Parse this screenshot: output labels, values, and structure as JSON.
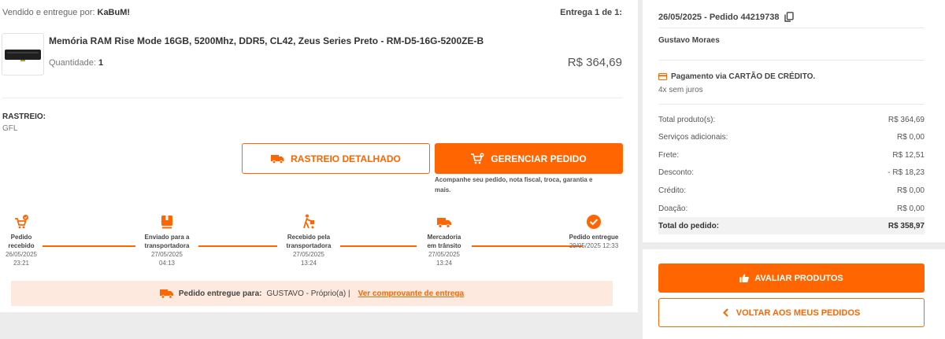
{
  "seller": {
    "prefix": "Vendido e entregue por:",
    "name": "KaBuM!"
  },
  "delivery_counter": "Entrega 1 de 1:",
  "product": {
    "name": "Memória RAM Rise Mode 16GB, 5200Mhz, DDR5, CL42, Zeus Series Preto - RM-D5-16G-5200ZE-B",
    "quantity_label": "Quantidade:",
    "quantity": "1",
    "price": "R$ 364,69"
  },
  "tracking": {
    "label": "RASTREIO:",
    "carrier": "GFL"
  },
  "buttons": {
    "tracking_detail": "RASTREIO DETALHADO",
    "manage_order": "GERENCIAR PEDIDO",
    "manage_help": "Acompanhe seu pedido, nota fiscal, troca, garantia e mais."
  },
  "timeline": [
    {
      "label_1": "Pedido",
      "label_2": "recebido",
      "date": "26/05/2025",
      "time": "23:21",
      "icon": "cart-check-icon"
    },
    {
      "label_1": "Enviado para a",
      "label_2": "transportadora",
      "date": "27/05/2025",
      "time": "04:13",
      "icon": "package-icon"
    },
    {
      "label_1": "Recebido pela",
      "label_2": "transportadora",
      "date": "27/05/2025",
      "time": "13:24",
      "icon": "hand-truck-icon"
    },
    {
      "label_1": "Mercadoria",
      "label_2": "em trânsito",
      "date": "27/05/2025",
      "time": "13:24",
      "icon": "truck-icon"
    },
    {
      "label_1": "Pedido entregue",
      "label_2": "",
      "date": "29/05/2025 12:33",
      "time": "",
      "icon": "check-circle-icon"
    }
  ],
  "delivered_banner": {
    "label": "Pedido entregue para:",
    "recipient": "GUSTAVO - Próprio(a) |",
    "link": "Ver comprovante de entrega"
  },
  "order": {
    "header": "26/05/2025 - Pedido 44219738",
    "customer": "Gustavo Moraes"
  },
  "payment": {
    "method": "Pagamento via CARTÃO DE CRÉDITO.",
    "installments": "4x sem juros"
  },
  "summary": [
    {
      "label": "Total produto(s):",
      "value": "R$ 364,69"
    },
    {
      "label": "Serviços adicionais:",
      "value": "R$ 0,00"
    },
    {
      "label": "Frete:",
      "value": "R$ 12,51"
    },
    {
      "label": "Desconto:",
      "value": "- R$ 18,23"
    },
    {
      "label": "Crédito:",
      "value": "R$ 0,00"
    },
    {
      "label": "Doação:",
      "value": "R$ 0,00"
    }
  ],
  "total": {
    "label": "Total do pedido:",
    "value": "R$ 358,97"
  },
  "actions": {
    "evaluate": "AVALIAR PRODUTOS",
    "back": "VOLTAR AOS MEUS PEDIDOS"
  },
  "colors": {
    "accent": "#ff6500",
    "banner_bg": "#fde9de"
  }
}
